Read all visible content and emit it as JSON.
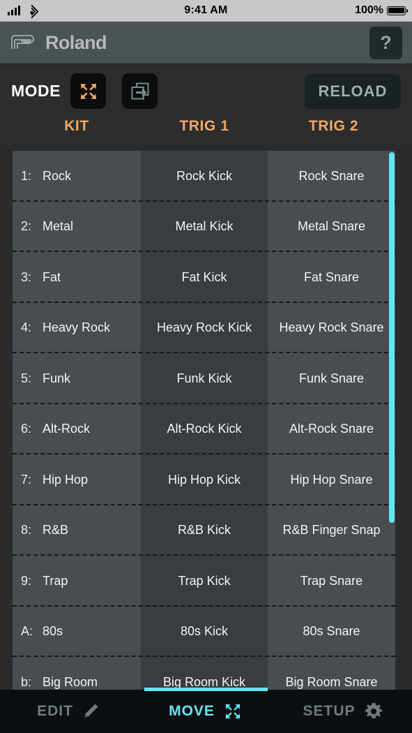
{
  "statusbar": {
    "signal_icon": "cellular-signal-icon",
    "wifi_icon": "wifi-icon",
    "time": "9:41 AM",
    "battery_percent": "100%",
    "battery_icon": "battery-full-icon"
  },
  "brandbar": {
    "logo_text": "Roland",
    "logo_icon": "roland-logo-icon",
    "help_label": "?"
  },
  "mode": {
    "label": "MODE",
    "buttons": [
      {
        "name": "move-mode-icon",
        "state": "selected",
        "color": "#f0a868"
      },
      {
        "name": "copy-mode-icon",
        "state": "unselected",
        "color": "#6e8f8c"
      }
    ],
    "reload_label": "RELOAD"
  },
  "columns": {
    "kit": "KIT",
    "trig1": "TRIG 1",
    "trig2": "TRIG 2",
    "accent_color": "#f0a868"
  },
  "rows": [
    {
      "index": "1:",
      "kit": "Rock",
      "trig1": "Rock Kick",
      "trig2": "Rock Snare"
    },
    {
      "index": "2:",
      "kit": "Metal",
      "trig1": "Metal Kick",
      "trig2": "Metal Snare"
    },
    {
      "index": "3:",
      "kit": "Fat",
      "trig1": "Fat Kick",
      "trig2": "Fat Snare"
    },
    {
      "index": "4:",
      "kit": "Heavy Rock",
      "trig1": "Heavy Rock Kick",
      "trig2": "Heavy Rock Snare"
    },
    {
      "index": "5:",
      "kit": "Funk",
      "trig1": "Funk Kick",
      "trig2": "Funk Snare"
    },
    {
      "index": "6:",
      "kit": "Alt-Rock",
      "trig1": "Alt-Rock Kick",
      "trig2": "Alt-Rock Snare"
    },
    {
      "index": "7:",
      "kit": "Hip Hop",
      "trig1": "Hip Hop Kick",
      "trig2": "Hip Hop Snare"
    },
    {
      "index": "8:",
      "kit": "R&B",
      "trig1": "R&B Kick",
      "trig2": "R&B Finger Snap"
    },
    {
      "index": "9:",
      "kit": "Trap",
      "trig1": "Trap Kick",
      "trig2": "Trap Snare"
    },
    {
      "index": "A:",
      "kit": "80s",
      "trig1": "80s Kick",
      "trig2": "80s Snare"
    },
    {
      "index": "b:",
      "kit": "Big Room",
      "trig1": "Big Room Kick",
      "trig2": "Big Room Snare"
    }
  ],
  "scrollbar": {
    "color": "#63e6f0"
  },
  "tabs": [
    {
      "label": "EDIT",
      "icon": "pencil-icon",
      "active": false
    },
    {
      "label": "MOVE",
      "icon": "move-arrows-icon",
      "active": true
    },
    {
      "label": "SETUP",
      "icon": "gear-icon",
      "active": false
    }
  ],
  "theme": {
    "accent_orange": "#f0a868",
    "accent_cyan": "#63e6f0",
    "bg_dark": "#2d2d2d",
    "row_light": "#474d50",
    "row_dark": "#373d40"
  }
}
